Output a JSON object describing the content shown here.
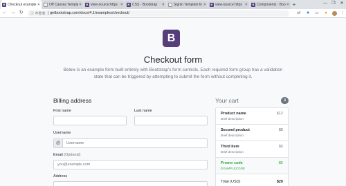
{
  "browser": {
    "tabs": [
      {
        "label": "Checkout example",
        "icon": "bootstrap-icon",
        "active": true
      },
      {
        "label": "Off Canvas Template",
        "icon": "document-icon",
        "active": false
      },
      {
        "label": "view-source:https",
        "icon": "bootstrap-icon",
        "active": false
      },
      {
        "label": "CSS · Bootstrap",
        "icon": "bootstrap-icon",
        "active": false
      },
      {
        "label": "Signin Template fo",
        "icon": "document-icon",
        "active": false
      },
      {
        "label": "view-source:https",
        "icon": "bootstrap-icon",
        "active": false
      },
      {
        "label": "Components · Boo",
        "icon": "bootstrap-icon",
        "active": false
      }
    ],
    "new_tab": "+",
    "security_label": "不安全",
    "url": "getbootstrap.com/docs/4.1/examples/checkout/",
    "window_controls": [
      "—",
      "❐",
      "✕"
    ]
  },
  "page": {
    "logo_letter": "B",
    "title": "Checkout form",
    "lead": "Below is an example form built entirely with Bootstrap's form controls. Each required form group has a validation state that can be triggered by attempting to submit the form without completing it.",
    "billing": {
      "heading": "Billing address",
      "first_name_label": "First name",
      "last_name_label": "Last name",
      "username_label": "Username",
      "at_symbol": "@",
      "username_placeholder": "Username",
      "email_label": "Email",
      "email_optional": "(Optional)",
      "email_placeholder": "you@example.com",
      "address_label": "Address"
    },
    "cart": {
      "heading": "Your cart",
      "count": "3",
      "items": [
        {
          "name": "Product name",
          "desc": "Brief description",
          "price": "$12"
        },
        {
          "name": "Second product",
          "desc": "Brief description",
          "price": "$8"
        },
        {
          "name": "Third item",
          "desc": "Brief description",
          "price": "$5"
        }
      ],
      "promo": {
        "name": "Promo code",
        "code": "EXAMPLECODE",
        "amount": "-$5"
      },
      "total_label": "Total (USD)",
      "total_value": "$20"
    }
  }
}
